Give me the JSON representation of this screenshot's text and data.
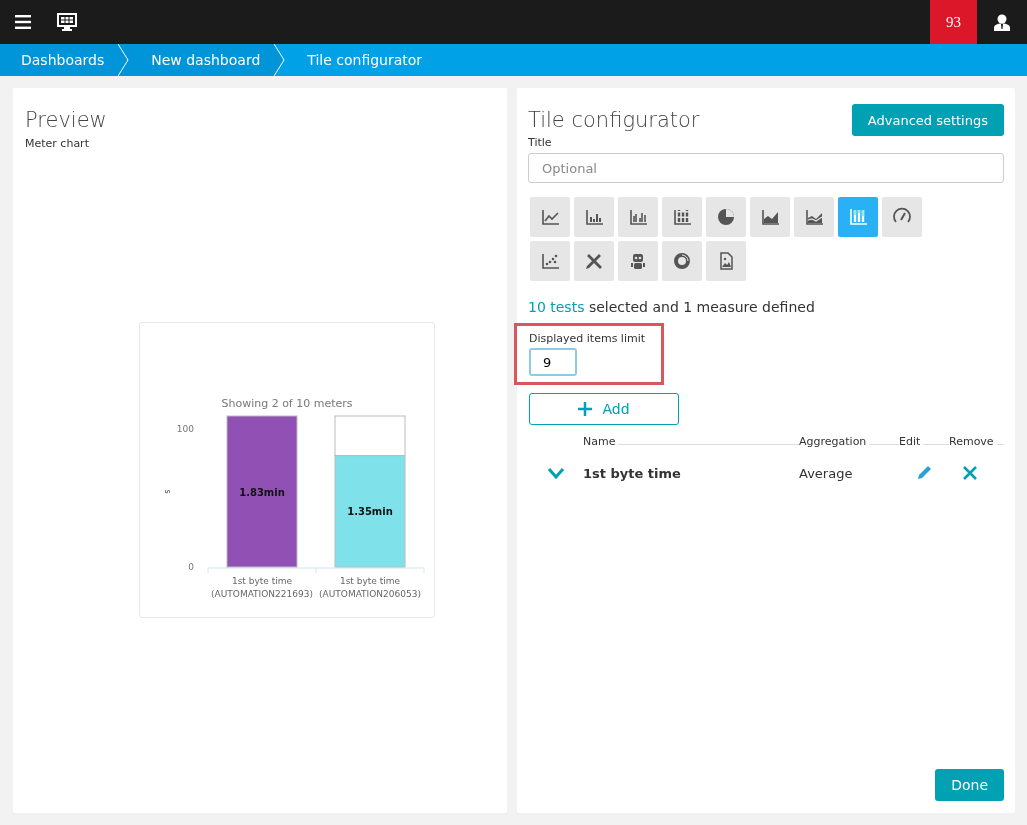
{
  "top_bar": {
    "problems_count": "93"
  },
  "breadcrumbs": [
    {
      "label": "Dashboards",
      "selected": false
    },
    {
      "label": "New dashboard",
      "selected": false
    },
    {
      "label": "Tile configurator",
      "selected": true
    }
  ],
  "preview": {
    "title": "Preview",
    "subtitle": "Meter chart",
    "chart_data": {
      "type": "bar",
      "title": "Showing 2 of 10 meters",
      "ylabel": "s",
      "categories": [
        "1st byte time\n(AUTOMATION221693)",
        "1st byte time\n(AUTOMATION206053)"
      ],
      "series": [
        {
          "color": "#9150b4",
          "values": [
            109.8,
            null
          ]
        },
        {
          "color": "#7fe1e9",
          "values": [
            null,
            81
          ]
        }
      ],
      "ylim": [
        0,
        109.8
      ],
      "yticks": [
        0,
        100
      ],
      "value_labels": [
        "1.83min",
        "1.35min"
      ]
    }
  },
  "configurator": {
    "title": "Tile configurator",
    "advanced_button": "Advanced settings",
    "title_label": "Title",
    "title_placeholder": "Optional",
    "chart_types": [
      {
        "kind": "line",
        "selected": false
      },
      {
        "kind": "bar",
        "selected": false
      },
      {
        "kind": "grouped",
        "selected": false
      },
      {
        "kind": "stacked",
        "selected": false
      },
      {
        "kind": "pie",
        "selected": false
      },
      {
        "kind": "area",
        "selected": false
      },
      {
        "kind": "multiarea",
        "selected": false
      },
      {
        "kind": "meter",
        "selected": true
      },
      {
        "kind": "gauge",
        "selected": false
      },
      {
        "kind": "scatter",
        "selected": false
      },
      {
        "kind": "tools",
        "selected": false
      },
      {
        "kind": "robot",
        "selected": false
      },
      {
        "kind": "donut",
        "selected": false
      },
      {
        "kind": "image",
        "selected": false
      }
    ],
    "summary_link": "10 tests",
    "summary_text": "selected and 1 measure defined",
    "limit_label": "Displayed items limit",
    "limit_value": "9",
    "add_button": "Add",
    "columns": [
      "Name",
      "Aggregation",
      "Edit",
      "Remove"
    ],
    "measures": [
      {
        "name": "1st byte time",
        "aggregation": "Average",
        "expanded": false
      }
    ],
    "done_button": "Done"
  }
}
